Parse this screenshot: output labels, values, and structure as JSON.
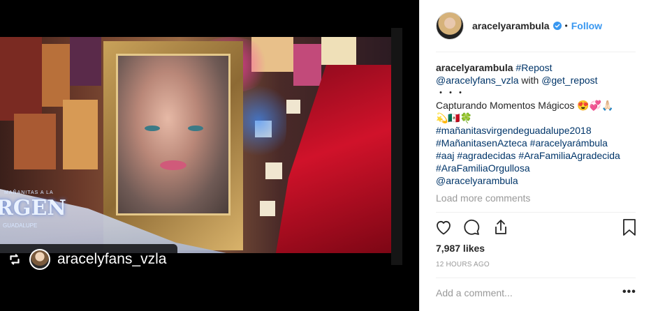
{
  "post": {
    "username": "aracelyarambula",
    "follow_label": "Follow",
    "dot": "•",
    "caption_user": "aracelyarambula",
    "caption_tag_repost": "#Repost",
    "caption_mention_1": "@aracelyfans_vzla",
    "caption_with": "with",
    "caption_mention_2": "@get_repost",
    "caption_dots": "・・・",
    "caption_text": "Capturando Momentos Mágicos 😍💞🙏🏻",
    "caption_emojis": "💫🇲🇽🍀",
    "hashtags": [
      "#mañanitasvirgendeguadalupe2018",
      "#MañanitasenAzteca",
      "#aracelyarámbula",
      "#aaj",
      "#agradecidas",
      "#AraFamiliaAgradecida",
      "#AraFamiliaOrgullosa"
    ],
    "caption_end_mention": "@aracelyarambula",
    "load_more": "Load more comments",
    "likes": "7,987 likes",
    "time_ago": "12 HOURS AGO",
    "comment_placeholder": "Add a comment...",
    "more_label": "•••"
  },
  "media": {
    "repost_username": "aracelyfans_vzla",
    "tv_logo_small": "MAÑANITAS A LA",
    "tv_logo_big": "RGEN",
    "tv_logo_bottom": "GUADALUPE"
  },
  "icons": [
    "verified-badge-icon",
    "heart-icon",
    "comment-icon",
    "share-icon",
    "bookmark-icon",
    "repost-icon"
  ],
  "colors": {
    "link": "#003569",
    "follow": "#3897f0",
    "muted": "#999999",
    "text": "#262626"
  }
}
